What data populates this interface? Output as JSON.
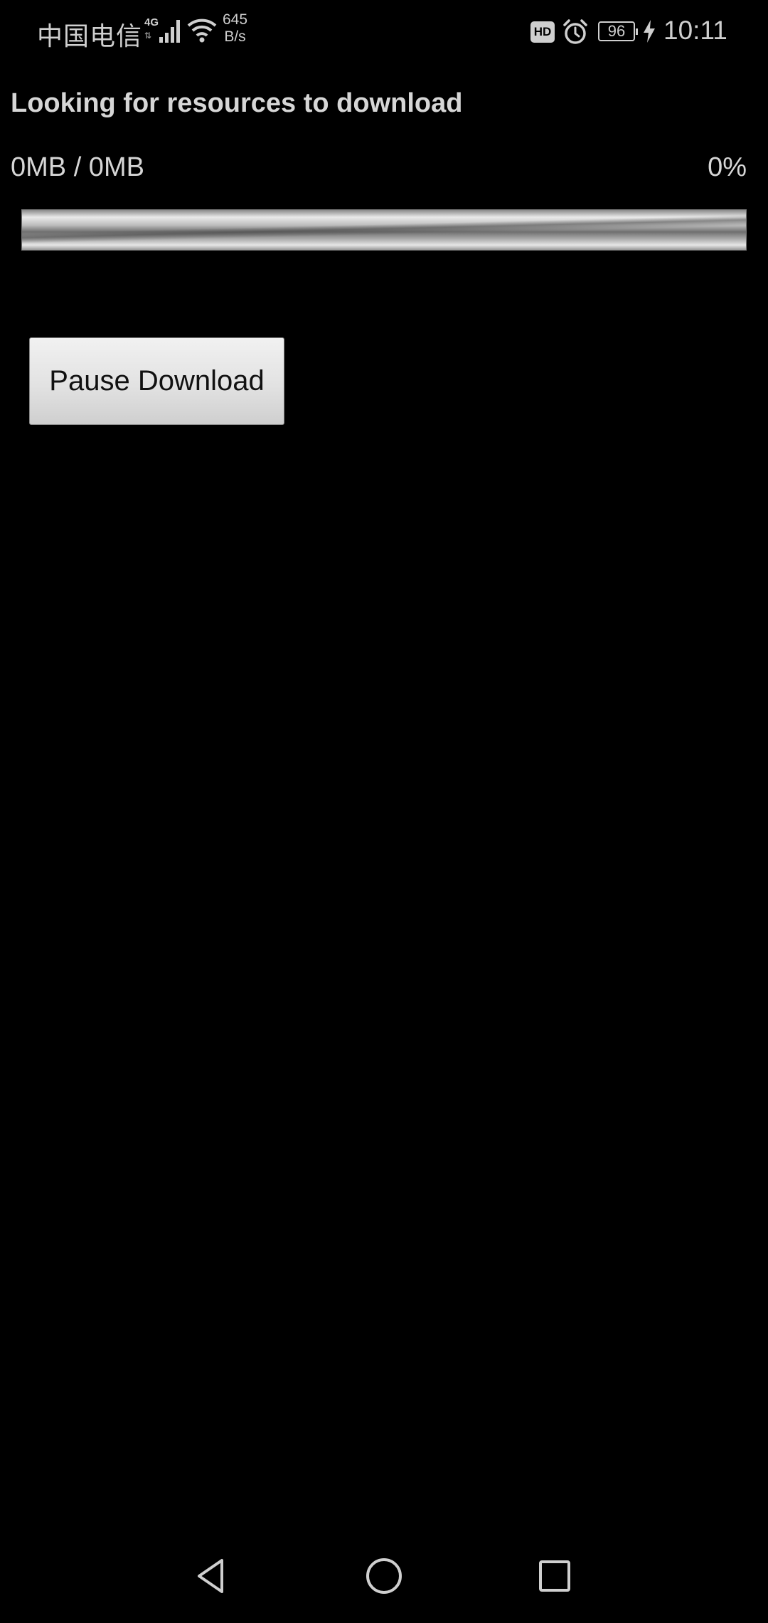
{
  "status_bar": {
    "carrier": "中国电信",
    "network_type": "4G",
    "speed_value": "645",
    "speed_unit": "B/s",
    "hd_badge": "HD",
    "battery_level": "96",
    "time": "10:11",
    "icons": [
      "signal-icon",
      "wifi-icon",
      "alarm-icon",
      "battery-icon",
      "charging-icon"
    ]
  },
  "download": {
    "title": "Looking for resources to download",
    "size_text": "0MB / 0MB",
    "percent_text": "0%",
    "progress": 0,
    "pause_label": "Pause Download"
  },
  "nav_bar": {
    "icons": [
      "back-icon",
      "home-icon",
      "recents-icon"
    ]
  }
}
